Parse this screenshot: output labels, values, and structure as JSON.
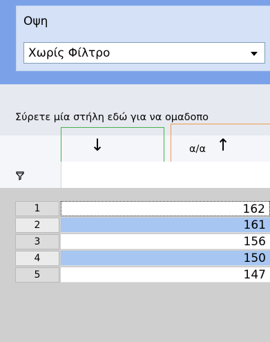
{
  "view": {
    "label": "Οψη",
    "selected": "Χωρίς Φίλτρο"
  },
  "grid": {
    "group_hint": "Σύρετε μία στήλη εδώ για να ομαδοπο",
    "column_title": "α/α",
    "sort_desc_symbol": "↓",
    "sort_asc_symbol": "↑",
    "rows": [
      {
        "num": "1",
        "value": "162"
      },
      {
        "num": "2",
        "value": "161"
      },
      {
        "num": "3",
        "value": "156"
      },
      {
        "num": "4",
        "value": "150"
      },
      {
        "num": "5",
        "value": "147"
      }
    ]
  },
  "colors": {
    "accent_panel": "#7ba2e8",
    "selected_row": "#a7c6f1",
    "desc_outline": "#44b34a",
    "asc_outline": "#f29a4d"
  }
}
